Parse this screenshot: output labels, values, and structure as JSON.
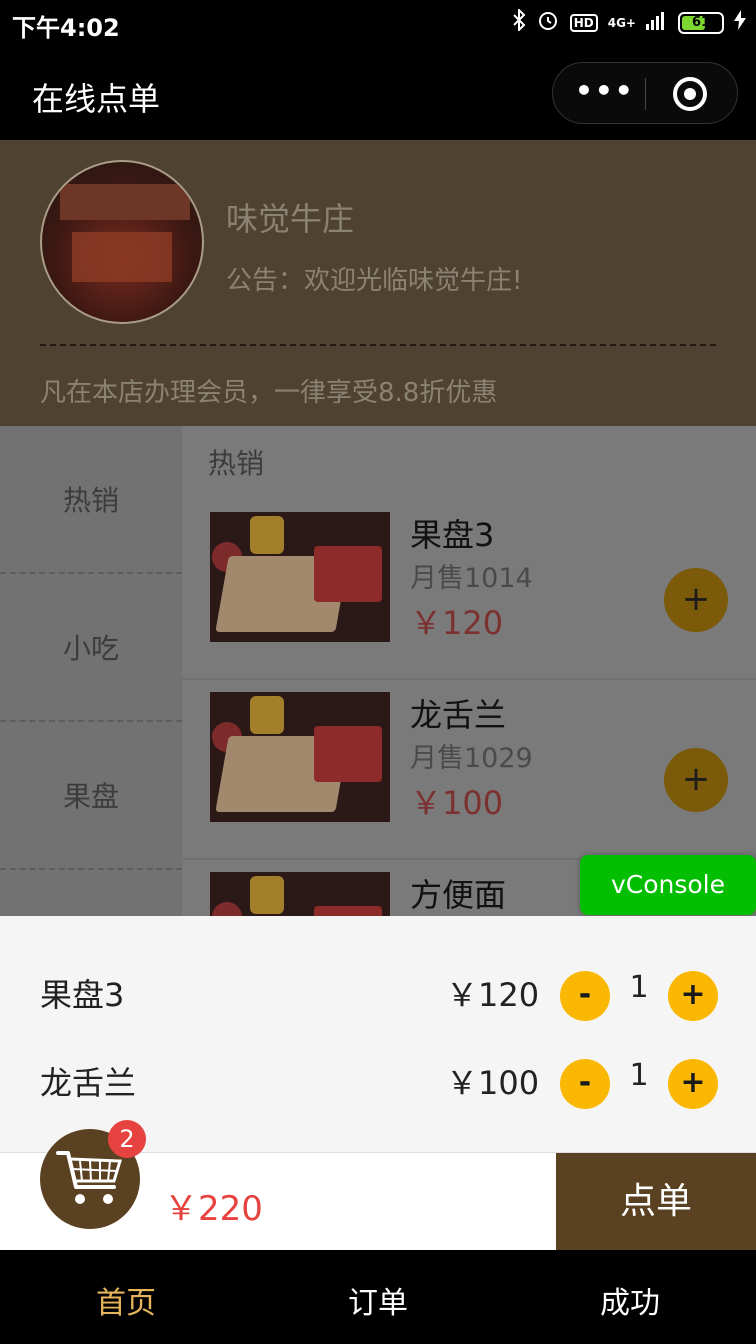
{
  "status_bar": {
    "time": "下午4:02",
    "network": "4G+",
    "hd": "HD",
    "battery": "61",
    "battery_level": 0.61
  },
  "nav": {
    "title": "在线点单",
    "more_icon": "more-dots-icon",
    "close_icon": "target-icon"
  },
  "store": {
    "name": "味觉牛庄",
    "notice": "公告：欢迎光临味觉牛庄!",
    "promo": "凡在本店办理会员，一律享受8.8折优惠"
  },
  "categories": [
    "热销",
    "小吃",
    "果盘"
  ],
  "section_title": "热销",
  "products": [
    {
      "name": "果盘3",
      "sales": "月售1014",
      "price": "￥120"
    },
    {
      "name": "龙舌兰",
      "sales": "月售1029",
      "price": "￥100"
    },
    {
      "name": "方便面",
      "sales": "",
      "price": ""
    }
  ],
  "vconsole": "vConsole",
  "cart": {
    "items": [
      {
        "name": "果盘3",
        "price": "￥120",
        "qty": "1",
        "minus": "-",
        "plus": "+"
      },
      {
        "name": "龙舌兰",
        "price": "￥100",
        "qty": "1",
        "minus": "-",
        "plus": "+"
      }
    ],
    "badge": "2",
    "total": "￥220",
    "order_label": "点单"
  },
  "add_label": "+",
  "tabs": [
    {
      "label": "首页",
      "active": true
    },
    {
      "label": "订单",
      "active": false
    },
    {
      "label": "成功",
      "active": false
    }
  ],
  "colors": {
    "accent": "#fab703",
    "brand_brown": "#5a4121",
    "price_red": "#e64340",
    "tab_active": "#e6b45a",
    "vconsole_green": "#04be02"
  }
}
